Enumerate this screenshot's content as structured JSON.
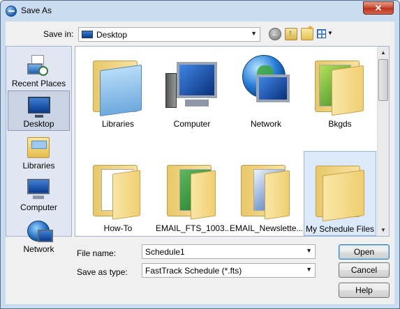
{
  "window": {
    "title": "Save As",
    "close_glyph": "✕"
  },
  "toolbar": {
    "save_in_label": "Save in:",
    "save_in_value": "Desktop",
    "dropdown_arrow": "▼",
    "views_arrow": "▼"
  },
  "places": [
    {
      "label": "Recent Places",
      "icon": "recent-places-icon"
    },
    {
      "label": "Desktop",
      "icon": "desktop-icon",
      "selected": true
    },
    {
      "label": "Libraries",
      "icon": "libraries-icon"
    },
    {
      "label": "Computer",
      "icon": "computer-icon"
    },
    {
      "label": "Network",
      "icon": "network-icon"
    }
  ],
  "items": [
    {
      "label": "Libraries",
      "icon": "libraries-folder-icon"
    },
    {
      "label": "Computer",
      "icon": "computer-icon"
    },
    {
      "label": "Network",
      "icon": "network-globe-icon"
    },
    {
      "label": "Bkgds",
      "icon": "folder-icon"
    },
    {
      "label": "How-To",
      "icon": "folder-icon"
    },
    {
      "label": "EMAIL_FTS_1003...",
      "icon": "folder-icon"
    },
    {
      "label": "EMAIL_Newslette...",
      "icon": "folder-icon"
    },
    {
      "label": "My Schedule Files",
      "icon": "folder-icon",
      "selected": true
    }
  ],
  "form": {
    "file_name_label": "File name:",
    "file_name_value": "Schedule1",
    "save_as_type_label": "Save as type:",
    "save_as_type_value": "FastTrack Schedule (*.fts)"
  },
  "buttons": {
    "open": "Open",
    "cancel": "Cancel",
    "help": "Help"
  },
  "scrollbar": {
    "up": "▲",
    "down": "▼"
  }
}
